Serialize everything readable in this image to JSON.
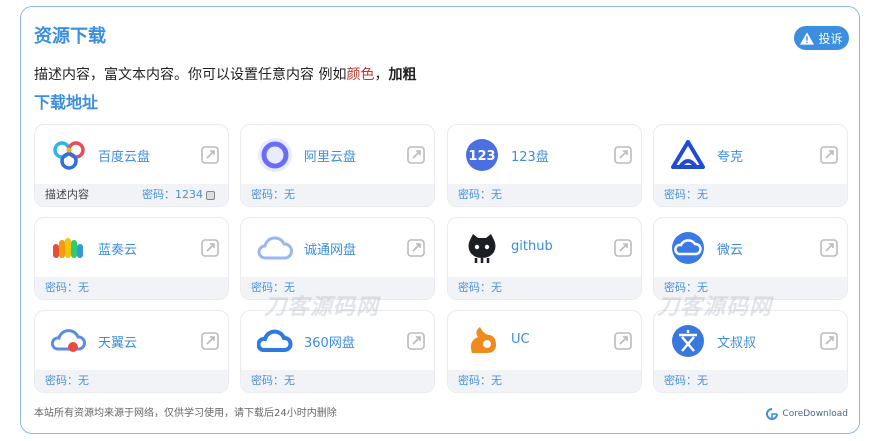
{
  "header": {
    "title": "资源下载",
    "report_label": "投诉"
  },
  "description": {
    "text": "描述内容，富文本内容。你可以设置任意内容 例如",
    "red": "颜色",
    "sep": "，",
    "bold": "加粗"
  },
  "download_heading": "下载地址",
  "cards": [
    {
      "name": "百度云盘",
      "icon": "baidu-cloud-icon",
      "note": "描述内容",
      "password": "密码：1234"
    },
    {
      "name": "阿里云盘",
      "icon": "aliyun-drive-icon",
      "note": "",
      "password": "密码：无"
    },
    {
      "name": "123盘",
      "icon": "123pan-icon",
      "note": "",
      "password": "密码：无"
    },
    {
      "name": "夸克",
      "icon": "quark-icon",
      "note": "",
      "password": "密码：无"
    },
    {
      "name": "蓝奏云",
      "icon": "lanzou-cloud-icon",
      "note": "",
      "password": "密码：无"
    },
    {
      "name": "诚通网盘",
      "icon": "ctfile-icon",
      "note": "",
      "password": "密码：无"
    },
    {
      "name": "github",
      "icon": "github-icon",
      "note": "",
      "password": "密码：无"
    },
    {
      "name": "微云",
      "icon": "weiyun-icon",
      "note": "",
      "password": "密码：无"
    },
    {
      "name": "天翼云",
      "icon": "tianyi-cloud-icon",
      "note": "",
      "password": "密码：无"
    },
    {
      "name": "360网盘",
      "icon": "360-pan-icon",
      "note": "",
      "password": "密码：无"
    },
    {
      "name": "UC",
      "icon": "uc-icon",
      "note": "",
      "password": "密码：无"
    },
    {
      "name": "文叔叔",
      "icon": "wenshushu-icon",
      "note": "",
      "password": "密码：无"
    }
  ],
  "footer": {
    "note": "本站所有资源均来源于网络，仅供学习使用，请下载后24小时内删除",
    "brand": "CoreDownload"
  },
  "watermark": "刀客源码网",
  "colors": {
    "accent": "#3b8ee0",
    "red": "#c0392b",
    "bar": "#f1f3f6"
  }
}
